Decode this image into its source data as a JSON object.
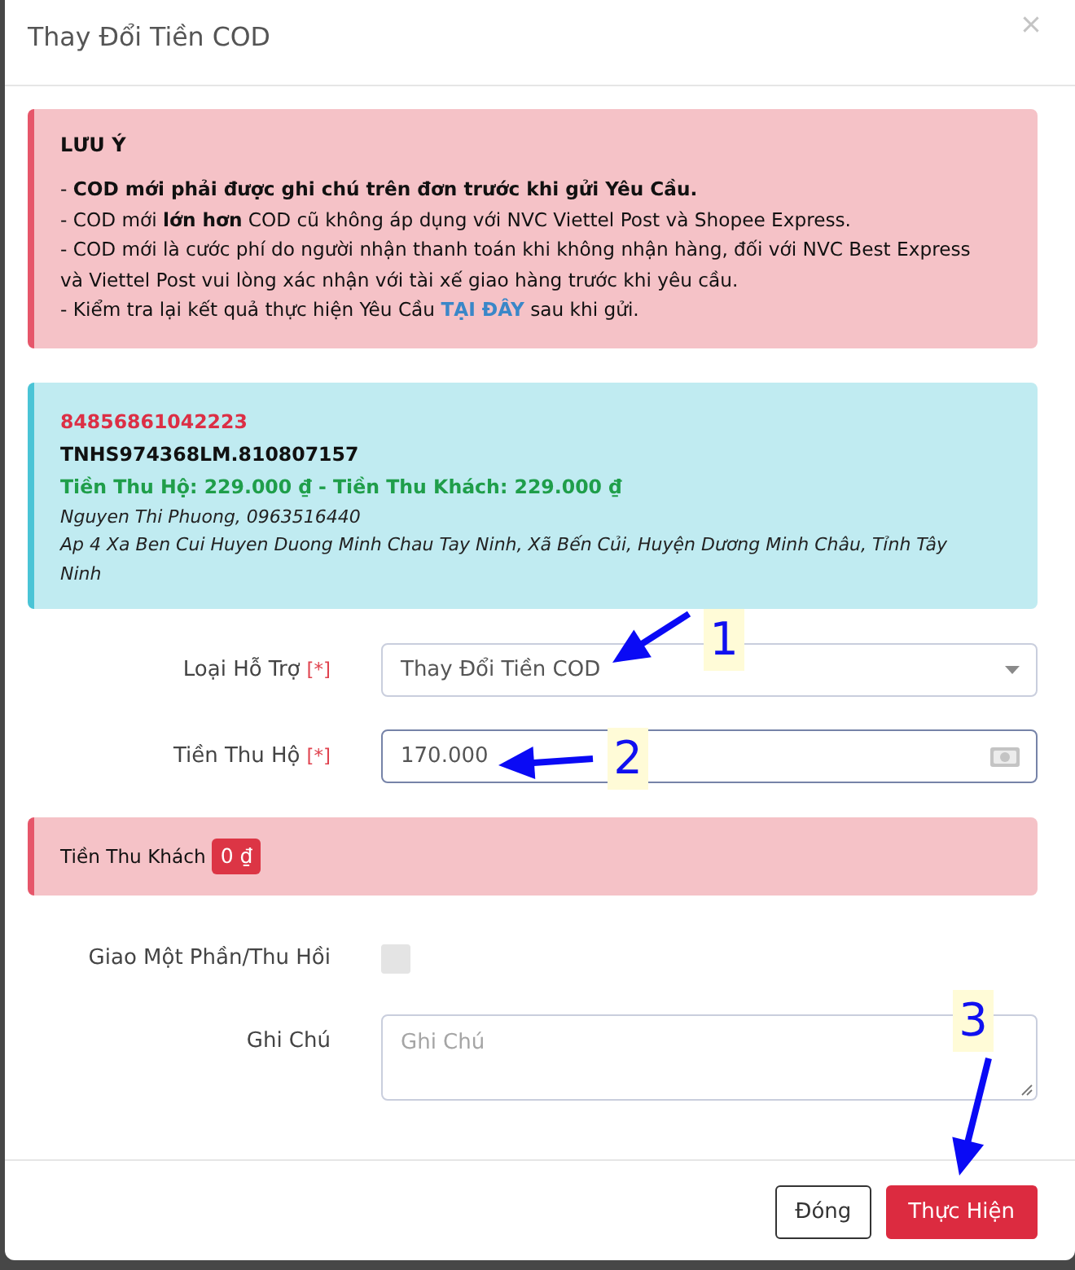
{
  "dialog": {
    "title": "Thay Đổi Tiền COD"
  },
  "notice": {
    "heading": "LƯU Ý",
    "lines": [
      {
        "text": "- **COD mới phải được ghi chú trên đơn trước khi gửi Yêu Cầu.**"
      },
      {
        "text": "- COD mới **lớn hơn** COD cũ không áp dụng với NVC Viettel Post và Shopee Express."
      },
      {
        "text": "- COD mới là cước phí do người nhận thanh toán khi không nhận hàng, đối với NVC Best Express và Viettel Post vui lòng xác nhận với tài xế giao hàng trước khi yêu cầu."
      },
      {
        "text": "- Kiểm tra lại kết quả thực hiện Yêu Cầu",
        "link": "TẠI ĐÂY",
        "after": "sau khi gửi."
      }
    ]
  },
  "order": {
    "code": "84856861042223",
    "reference": "TNHS974368LM.810807157",
    "amounts": "Tiền Thu Hộ: 229.000 ₫ - Tiền Thu Khách: 229.000 ₫",
    "customer": "Nguyen Thi Phuong, 0963516440",
    "address": "Ap 4 Xa Ben Cui Huyen Duong Minh Chau Tay Ninh, Xã Bến Củi, Huyện Dương Minh Châu, Tỉnh Tây Ninh"
  },
  "form_rows": [
    {
      "kind": "select",
      "label": "Loại Hỗ Trợ",
      "required_mark": "[*]",
      "value": "Thay Đổi Tiền COD",
      "focused": false
    },
    {
      "kind": "input",
      "label": "Tiền Thu Hộ",
      "required_mark": "[*]",
      "value": "170.000",
      "focused": true
    },
    {
      "kind": "summary",
      "label": "Tiền Thu Khách",
      "badge": "0 ₫"
    },
    {
      "kind": "checkbox",
      "label": "Giao Một Phần/Thu Hồi",
      "checked": false
    },
    {
      "kind": "textarea",
      "label": "Ghi Chú",
      "placeholder": "Ghi Chú",
      "focused": false
    }
  ],
  "footer": {
    "buttons": [
      {
        "label": "Đóng",
        "kind": "secondary"
      },
      {
        "label": "Thực Hiện",
        "kind": "primary"
      }
    ]
  },
  "annotations": [
    {
      "label": "1"
    },
    {
      "label": "2"
    },
    {
      "label": "3"
    }
  ]
}
